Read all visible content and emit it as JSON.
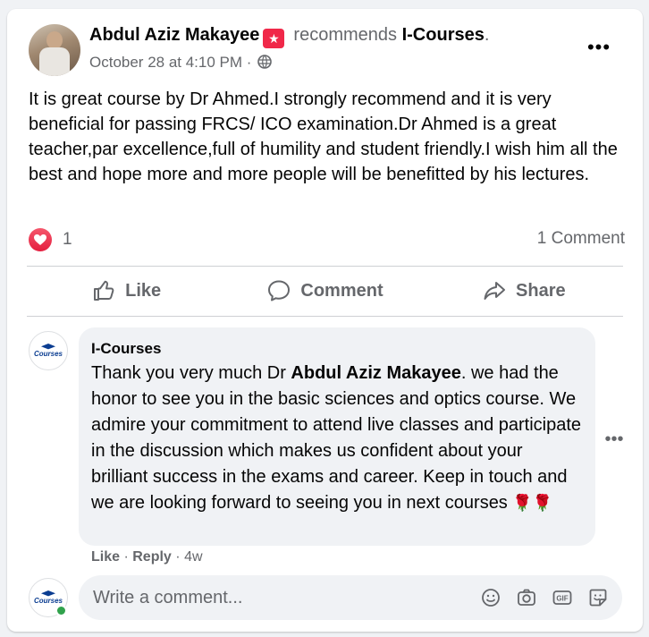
{
  "post": {
    "author": "Abdul Aziz Makayee",
    "recommends_text": "recommends",
    "page_name": "I-Courses",
    "end_dot": ".",
    "date": "October 28 at 4:10 PM",
    "separator": "·",
    "more_label": "•••",
    "text": "It is great course by Dr Ahmed.I strongly recommend and it is very beneficial for passing FRCS/ ICO examination.Dr Ahmed is a great teacher,par excellence,full of humility and student friendly.I wish him all the best and hope more and more people will be benefitted by his lectures.",
    "reaction_count": "1",
    "comments_count": "1 Comment"
  },
  "actions": {
    "like": "Like",
    "comment": "Comment",
    "share": "Share"
  },
  "comment": {
    "author": "I-Courses",
    "text_before": "Thank you very much Dr ",
    "mention": "Abdul Aziz Makayee",
    "text_after": ". we had the honor to see you in the basic sciences and optics course. We admire your commitment to attend live classes and participate in the discussion which makes us confident about your brilliant success in the exams and career. Keep in touch and we are looking forward to seeing you in next courses",
    "emoji": "🌹🌹",
    "like_label": "Like",
    "reply_label": "Reply",
    "age": "4w",
    "dot": "·",
    "more_label": "•••"
  },
  "composer": {
    "placeholder": "Write a comment...",
    "logo_text": "Courses",
    "tools": [
      "emoji-icon",
      "camera-icon",
      "gif-icon",
      "sticker-icon"
    ]
  },
  "colors": {
    "reaction_red": "#e41e3f",
    "secondary_text": "#65676b",
    "online_green": "#31a24c",
    "badge_red": "#f02849"
  }
}
